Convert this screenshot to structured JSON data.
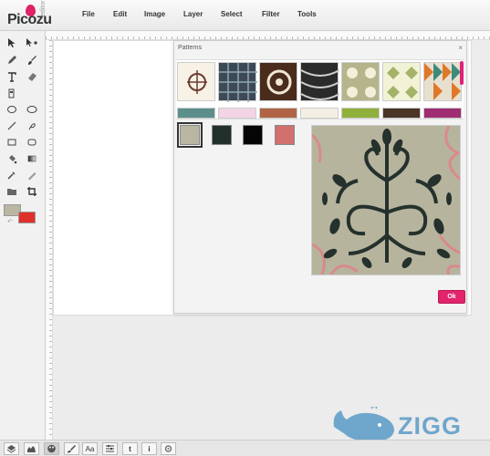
{
  "app": {
    "logo_text": "Picozu",
    "logo_sub": "editor",
    "accent": "#e0247a"
  },
  "menu": [
    "File",
    "Edit",
    "Image",
    "Layer",
    "Select",
    "Filter",
    "Tools"
  ],
  "toolbar": {
    "tools": [
      "select-arrow-icon",
      "move-plus-icon",
      "pencil-icon",
      "brush-icon",
      "text-icon",
      "eraser-icon",
      "clone-stamp-icon",
      "ellipse-icon",
      "rounded-rect-icon",
      "line-icon",
      "lasso-icon",
      "rect-icon",
      "rect-rounded-icon",
      "fill-bucket-icon",
      "gradient-icon",
      "eyedropper-icon",
      "ruler-icon",
      "folder-icon",
      "crop-icon"
    ],
    "foreground_color": "#b9b6a2",
    "background_color": "#e0302a"
  },
  "dialog": {
    "title": "Patterns",
    "close": "×",
    "swatches": [
      "#b9b6a2",
      "#22302c",
      "#050505",
      "#d2706e"
    ],
    "selected_swatch": 0,
    "ok_label": "Ok"
  },
  "bottom_bar": {
    "buttons": [
      "layers-icon",
      "histogram-icon",
      "palette-icon",
      "brush-icon",
      "font-icon",
      "adjust-icon",
      "tumblr-icon",
      "info-icon",
      "settings-icon"
    ],
    "font_label": "Aa",
    "tumblr_label": "t",
    "info_label": "i"
  },
  "watermark": {
    "text": "ZIGG",
    "color": "#6fa6cc"
  }
}
